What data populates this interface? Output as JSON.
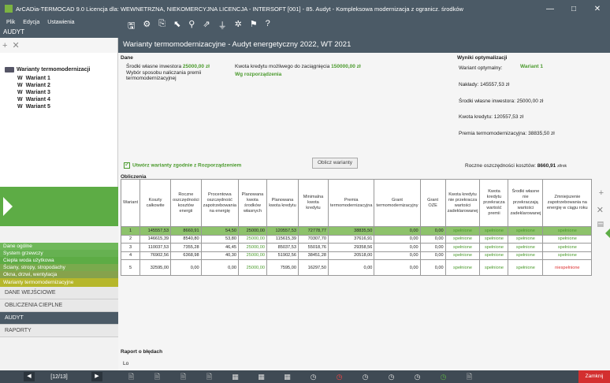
{
  "window": {
    "title": "ArCADia-TERMOCAD 9.0 Licencja dla: WEWNETRZNA, NIEKOMERCYJNA LICENCJA - INTERSOFT [001] - 85. Audyt - Kompleksowa modernizacja z ogranicz. środków",
    "min": "—",
    "max": "□",
    "close": "✕"
  },
  "menu": {
    "file": "Plik",
    "edit": "Edycja",
    "settings": "Ustawienia"
  },
  "app_name": "AUDYT",
  "doc_title": "Warianty termomodernizacyjne - Audyt energetyczny 2022, WT 2021",
  "toolbar_icons": [
    "save-icon",
    "settings-icon",
    "copy-icon",
    "arrow-icon",
    "filter-icon",
    "arrow-up-icon",
    "filter-icon",
    "gear-icon",
    "flag-icon",
    "help-icon"
  ],
  "tree": {
    "root": "Warianty termomodernizacji",
    "items": [
      "Wariant 1",
      "Wariant 2",
      "Wariant 3",
      "Wariant 4",
      "Wariant 5"
    ],
    "prefix": "W"
  },
  "nav": {
    "items": [
      "Dane ogólne",
      "System grzewczy",
      "Ciepła woda użytkowa",
      "Ściany, stropy, stropodachy",
      "Okna, drzwi, wentylacja",
      "Warianty termomodernizacyjne"
    ],
    "big": [
      "DANE WEJŚCIOWE",
      "OBLICZENIA CIEPLNE",
      "AUDYT",
      "RAPORTY"
    ],
    "page": "[12/13]"
  },
  "dane": {
    "header": "Dane",
    "own_label": "Środki własne inwestora",
    "own_value": "25000,00 zł",
    "method_label": "Wybór sposobu naliczania premii termomodernizacyjnej",
    "credit_label": "Kwota kredytu możliwego do zaciągnięcia",
    "credit_value": "150000,00 zł",
    "method_value": "Wg rozporządzenia"
  },
  "wyniki": {
    "header": "Wyniki optymalizacji",
    "optimal_label": "Wariant optymalny:",
    "optimal_value": "Wariant 1",
    "naklady": "Nakłady: 145557,53 zł",
    "srodki": "Środki własne inwestora: 25000,00 zł",
    "kredyt": "Kwota kredytu: 120557,53 zł",
    "premia": "Premia termomodernizacyjna: 38835,50 zł",
    "oszcz_label": "Roczne oszczędności kosztów:",
    "oszcz_value": "8660,91",
    "oszcz_unit": "zł/rok"
  },
  "calc_button": "Oblicz warianty",
  "checkbox_label": "Utwórz warianty zgodnie z Rozporządzeniem",
  "obliczenia": "Obliczenia",
  "table": {
    "headers": [
      "Wariant",
      "Koszty całkowite",
      "Roczne oszczędności kosztów energii",
      "Procentowa oszczędność zapotrzebowania na energię",
      "Planowana kwota środków własnych",
      "Planowana kwota kredytu",
      "Minimalna kwota kredytu",
      "Premia termomodernizacyjna",
      "Grant termomodernizacyjny",
      "Grant OZE",
      "Kwota kredytu nie przekracza wartości zadeklarowanej",
      "Kwota kredytu przekracza wartość premii",
      "Środki własne nie przekraczają wartości zadeklarowanej",
      "Zmniejszenie zapotrzebowania na energię w ciągu roku"
    ],
    "rows": [
      [
        "1",
        "145557,53",
        "8660,91",
        "54,50",
        "25000,00",
        "120557,53",
        "72778,77",
        "38835,50",
        "0,00",
        "0,00",
        "spełnione",
        "spełnione",
        "spełnione",
        "spełnione"
      ],
      [
        "2",
        "146615,39",
        "8540,80",
        "53,80",
        "25000,00",
        "115615,39",
        "70307,70",
        "37616,91",
        "0,00",
        "0,00",
        "spełnione",
        "spełnione",
        "spełnione",
        "spełnione"
      ],
      [
        "3",
        "110037,53",
        "7355,28",
        "46,45",
        "25000,00",
        "85037,53",
        "55018,76",
        "29358,56",
        "0,00",
        "0,00",
        "spełnione",
        "spełnione",
        "spełnione",
        "spełnione"
      ],
      [
        "4",
        "76902,56",
        "6368,98",
        "40,30",
        "25000,00",
        "51902,56",
        "38451,28",
        "20518,00",
        "0,00",
        "0,00",
        "spełnione",
        "spełnione",
        "spełnione",
        "spełnione"
      ],
      [
        "5",
        "32595,00",
        "0,00",
        "0,00",
        "25000,00",
        "7595,00",
        "16297,50",
        "0,00",
        "0,00",
        "0,00",
        "spełnione",
        "spełnione",
        "spełnione",
        "niespełnione"
      ]
    ]
  },
  "report": {
    "label": "Raport o błędach",
    "field": "Lo"
  },
  "close_button": "Zamknij",
  "colors": {
    "accent": "#5dac45",
    "header": "#4b5a66",
    "danger": "#d32f2f"
  }
}
